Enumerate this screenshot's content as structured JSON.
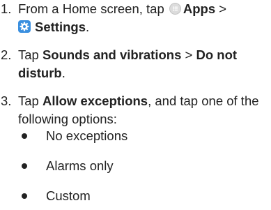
{
  "steps": [
    {
      "number": "1.",
      "prefix": "From a Home screen, tap",
      "apps_label": "Apps",
      "separator": ">",
      "apps_icon": "apps-grid-icon",
      "settings_icon": "gear-icon",
      "settings_label": "Settings",
      "suffix": "."
    },
    {
      "number": "2.",
      "prefix": "Tap",
      "bold1": "Sounds and vibrations",
      "separator": ">",
      "bold2": "Do not disturb",
      "suffix": "."
    },
    {
      "number": "3.",
      "prefix": "Tap",
      "bold1": "Allow exceptions",
      "suffix": ", and tap one of the following options:"
    }
  ],
  "options": [
    "No exceptions",
    "Alarms only",
    "Custom"
  ],
  "colors": {
    "text": "#222222",
    "settings_icon_bg": "#3a8fdf",
    "apps_icon_bg": "#dcdcdc"
  }
}
